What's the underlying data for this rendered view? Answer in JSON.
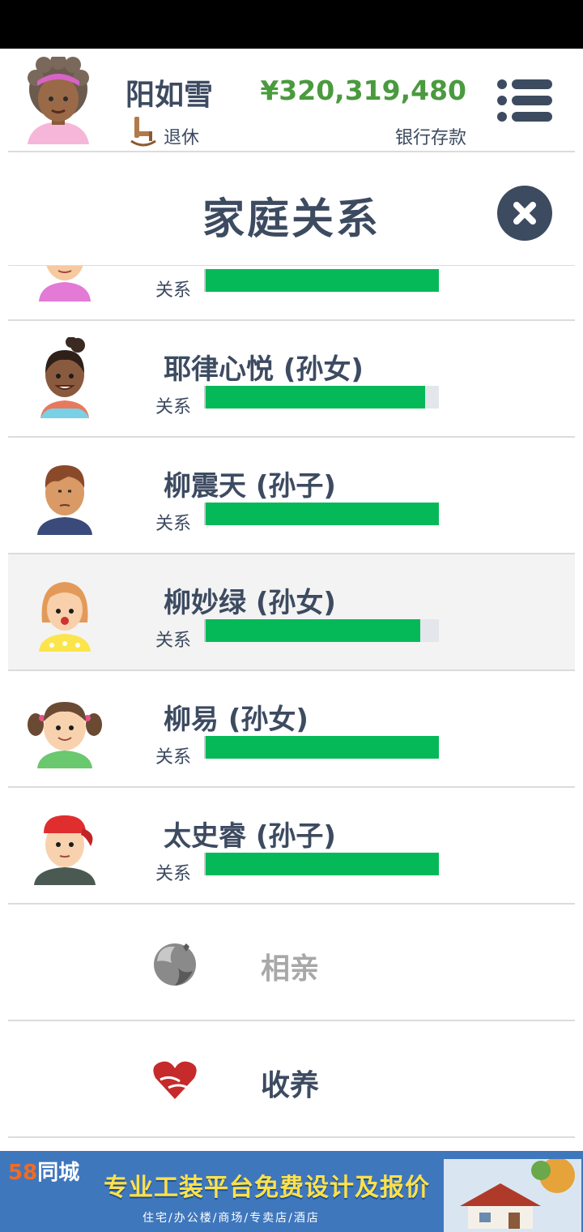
{
  "player": {
    "name": "阳如雪",
    "occupation": "退休",
    "money": "¥320,319,480",
    "money_label": "银行存款"
  },
  "panel": {
    "title": "家庭关系"
  },
  "relationships": [
    {
      "name": "",
      "relation_label": "关系",
      "level": 1.0
    },
    {
      "name": "耶律心悦 (孙女)",
      "relation_label": "关系",
      "level": 0.94
    },
    {
      "name": "柳震天 (孙子)",
      "relation_label": "关系",
      "level": 1.0
    },
    {
      "name": "柳妙绿 (孙女)",
      "relation_label": "关系",
      "level": 0.92
    },
    {
      "name": "柳易 (孙女)",
      "relation_label": "关系",
      "level": 1.0
    },
    {
      "name": "太史睿 (孙子)",
      "relation_label": "关系",
      "level": 1.0
    }
  ],
  "actions": {
    "dating": {
      "label": "相亲",
      "enabled": false
    },
    "adopt": {
      "label": "收养",
      "enabled": true
    }
  },
  "ad": {
    "logo_number": "58",
    "logo_text": "同城",
    "headline": "专业工装平台免费设计及报价",
    "subline": "住宅/办公楼/商场/专卖店/酒店"
  },
  "colors": {
    "primary": "#3d4b61",
    "money": "#4a9a3e",
    "bar_fill": "#06b958",
    "bar_track": "#e3e6ea",
    "highlight_row": "#f3f3f3",
    "disabled_text": "#a8a8a8",
    "ad_bg": "#3f77bd"
  }
}
